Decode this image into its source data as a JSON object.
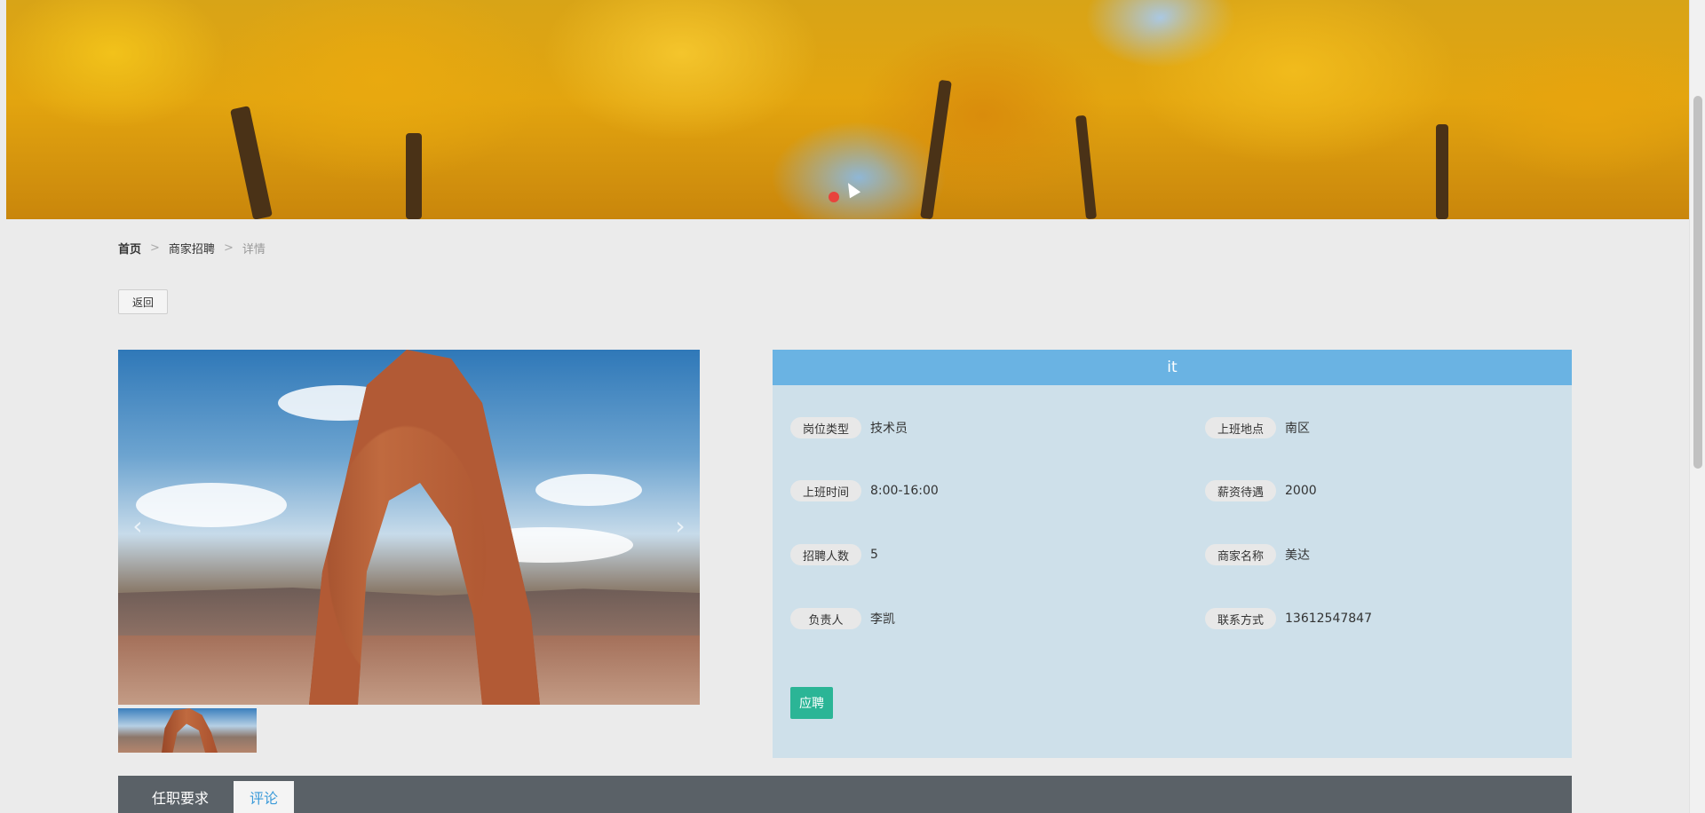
{
  "breadcrumb": {
    "home": "首页",
    "section": "商家招聘",
    "current": "详情",
    "separator": ">"
  },
  "back_button": "返回",
  "carousel": {
    "prev_glyph": "‹",
    "next_glyph": "›"
  },
  "job": {
    "title": "it",
    "fields": [
      {
        "label": "岗位类型",
        "value": "技术员"
      },
      {
        "label": "上班地点",
        "value": "南区"
      },
      {
        "label": "上班时间",
        "value": "8:00-16:00"
      },
      {
        "label": "薪资待遇",
        "value": "2000"
      },
      {
        "label": "招聘人数",
        "value": "5"
      },
      {
        "label": "商家名称",
        "value": "美达"
      },
      {
        "label": "负责人",
        "value": "李凯"
      },
      {
        "label": "联系方式",
        "value": "13612547847"
      }
    ],
    "apply_label": "应聘"
  },
  "tabs": [
    {
      "label": "任职要求",
      "active": false
    },
    {
      "label": "评论",
      "active": true
    }
  ],
  "colors": {
    "header_blue": "#6ab3e3",
    "panel_bg": "#cee0ea",
    "apply_green": "#2bb596",
    "tabs_bar": "#5a6167",
    "active_tab_text": "#3a9ad9",
    "carousel_dot": "#e8433c"
  }
}
